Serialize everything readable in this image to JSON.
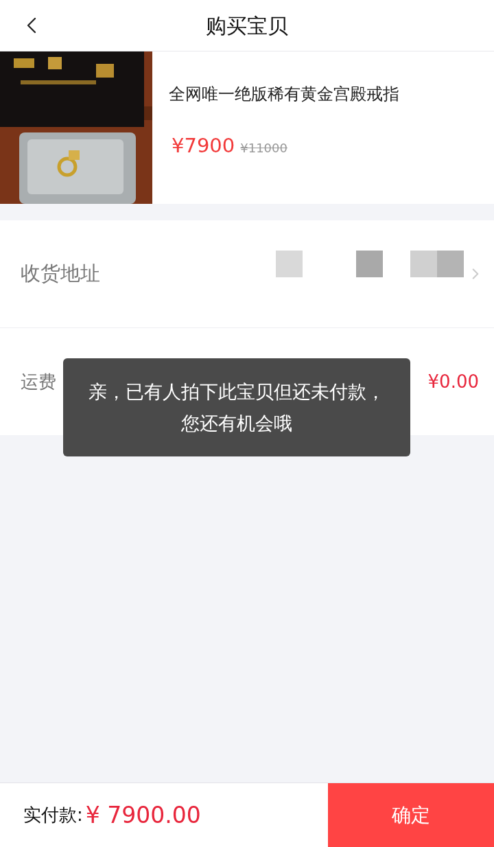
{
  "header": {
    "title": "购买宝贝"
  },
  "product": {
    "name": "全网唯一绝版稀有黄金宫殿戒指",
    "price": "¥7900",
    "original_price": "¥11000"
  },
  "address": {
    "label": "收货地址"
  },
  "shipping": {
    "label": "运费",
    "value": "¥0.00"
  },
  "toast": {
    "lines": [
      "亲，已有人拍下此宝贝但还未付款，",
      "您还有机会哦"
    ]
  },
  "footer": {
    "label": "实付款:",
    "amount": "¥ 7900.00",
    "button": "确定"
  }
}
